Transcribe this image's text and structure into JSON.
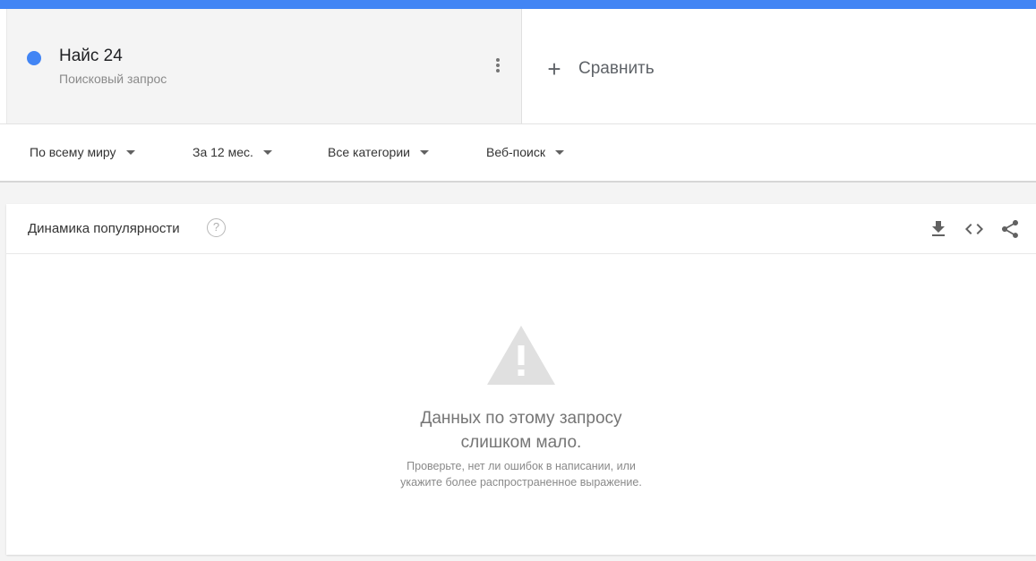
{
  "header": {
    "term": {
      "name": "Найс 24",
      "type": "Поисковый запрос",
      "color": "#4285f4"
    },
    "compare_label": "Сравнить"
  },
  "filters": [
    {
      "label": "По всему миру"
    },
    {
      "label": "За 12 мес."
    },
    {
      "label": "Все категории"
    },
    {
      "label": "Веб-поиск"
    }
  ],
  "panel": {
    "title": "Динамика популярности",
    "help_icon": "?",
    "tools": [
      "download-icon",
      "embed-code-icon",
      "share-icon"
    ],
    "empty": {
      "icon": "warning-icon",
      "title_line1": "Данных по этому запросу",
      "title_line2": "слишком мало.",
      "sub_line1": "Проверьте, нет ли ошибок в написании, или",
      "sub_line2": "укажите более распространенное выражение."
    }
  },
  "colors": {
    "accent": "#4285f4",
    "icon_gray": "#616161",
    "warning_gray": "#e0e0e0"
  }
}
